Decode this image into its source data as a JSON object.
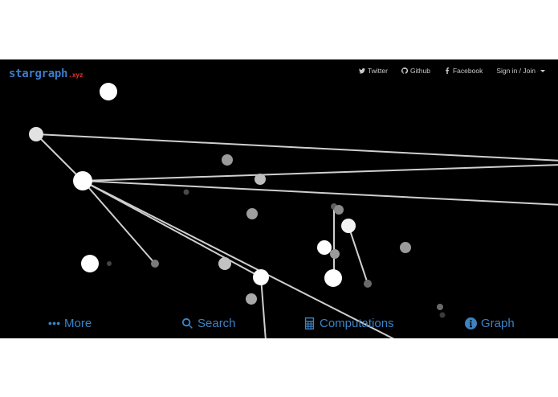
{
  "brand": {
    "name": "stargraph",
    "tld": ".xyz"
  },
  "top_nav": {
    "twitter": "Twitter",
    "github": "Github",
    "facebook": "Facebook",
    "signin": "Sign in / Join"
  },
  "bottom_nav": {
    "more": "More",
    "search": "Search",
    "computations": "Computations",
    "graph": "Graph"
  },
  "colors": {
    "background": "#000000",
    "accent": "#3d82c4",
    "logo_tld": "#e0352b",
    "node_bright": "#ffffff",
    "node_mid": "#c8c8c8",
    "node_dim": "#8a8a8a",
    "node_dark": "#4a4a4a",
    "edge": "#cfcfcf"
  },
  "icons": [
    "twitter-icon",
    "github-icon",
    "facebook-icon",
    "caret-down-icon",
    "ellipsis-icon",
    "search-icon",
    "calculator-icon",
    "info-circle-icon"
  ]
}
